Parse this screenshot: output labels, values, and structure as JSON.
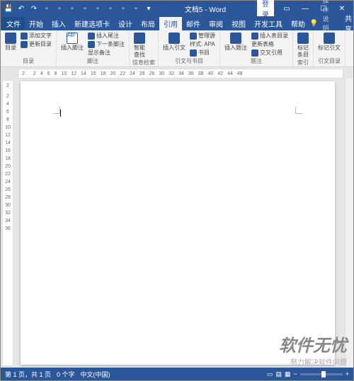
{
  "title_bar": {
    "doc_title": "文档5 - Word",
    "login": "登录"
  },
  "menu": {
    "file": "文件",
    "tabs": [
      "开始",
      "插入",
      "新建选项卡",
      "设计",
      "布局",
      "引用",
      "邮件",
      "审阅",
      "视图",
      "开发工具",
      "帮助"
    ],
    "active_index": 5,
    "search_placeholder": "操作说明搜索",
    "share": "共享"
  },
  "ribbon": {
    "groups": {
      "toc": {
        "label": "目录",
        "main": "目录",
        "add_text": "添加文字",
        "update": "更新目录"
      },
      "footnote": {
        "label": "脚注",
        "insert_fn": "插入脚注",
        "ab": "AB¹",
        "insert_en": "插入尾注",
        "next_fn": "下一条脚注",
        "show": "显示备注"
      },
      "research": {
        "label": "信息检索",
        "smart": "智能\n查找"
      },
      "citation": {
        "label": "引文与书目",
        "insert_cite": "插入引文",
        "manage": "管理源",
        "style": "样式:",
        "style_val": "APA",
        "biblio": "书目"
      },
      "caption": {
        "label": "题注",
        "insert_cap": "插入题注",
        "insert_tof": "插入表目录",
        "update_tbl": "更新表格",
        "cross_ref": "交叉引用"
      },
      "index": {
        "label": "索引",
        "mark": "标记\n条目"
      },
      "toa": {
        "label": "引文目录",
        "mark_cite": "标记引文"
      }
    }
  },
  "ruler": {
    "h": [
      "2",
      "",
      "2",
      "4",
      "6",
      "8",
      "10",
      "12",
      "14",
      "16",
      "18",
      "20",
      "22",
      "24",
      "26",
      "28",
      "30",
      "32",
      "34",
      "36",
      "38",
      "40",
      "42",
      "44",
      "48"
    ],
    "v": [
      "2",
      "",
      "2",
      "4",
      "6",
      "8",
      "10",
      "12",
      "14",
      "16",
      "18",
      "20",
      "22",
      "24",
      "26",
      "28",
      "30",
      "32",
      "34",
      "36"
    ]
  },
  "status": {
    "page": "第 1 页，共 1 页",
    "words": "0 个字",
    "lang": "中文(中国)"
  },
  "watermark": {
    "big": "软件无忧",
    "small": "努力解决软件问题"
  }
}
